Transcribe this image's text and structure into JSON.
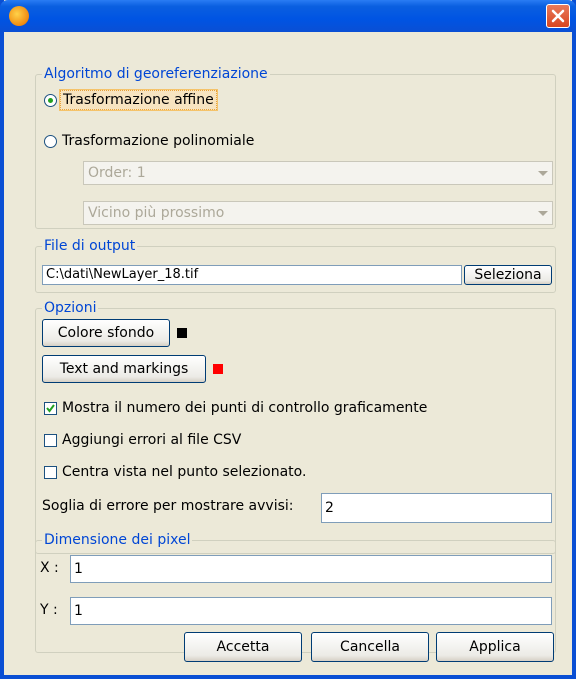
{
  "window": {
    "title": ""
  },
  "algorithm": {
    "title": "Algoritmo di georeferenziazione",
    "affine_label": "Trasformazione affine",
    "polynomial_label": "Trasformazione polinomiale",
    "selected": "affine",
    "order_value": "Order: 1",
    "interpolation_value": "Vicino più prossimo"
  },
  "output": {
    "title": "File di output",
    "path_value": "C:\\dati\\NewLayer_18.tif",
    "select_label": "Seleziona"
  },
  "options": {
    "title": "Opzioni",
    "background_color_label": "Colore sfondo",
    "background_color": "#000000",
    "text_markings_label": "Text and markings",
    "text_markings_color": "#ff0000",
    "show_points_label": "Mostra il numero dei punti di controllo graficamente",
    "show_points_checked": true,
    "add_errors_label": "Aggiungi errori al file CSV",
    "add_errors_checked": false,
    "center_view_label": "Centra vista nel punto selezionato.",
    "center_view_checked": false,
    "threshold_label": "Soglia di errore per mostrare avvisi:",
    "threshold_value": "2"
  },
  "pixel_size": {
    "title": "Dimensione dei pixel",
    "x_label": "X :",
    "x_value": "1",
    "y_label": "Y :",
    "y_value": "1"
  },
  "buttons": {
    "accept": "Accetta",
    "cancel": "Cancella",
    "apply": "Applica"
  }
}
